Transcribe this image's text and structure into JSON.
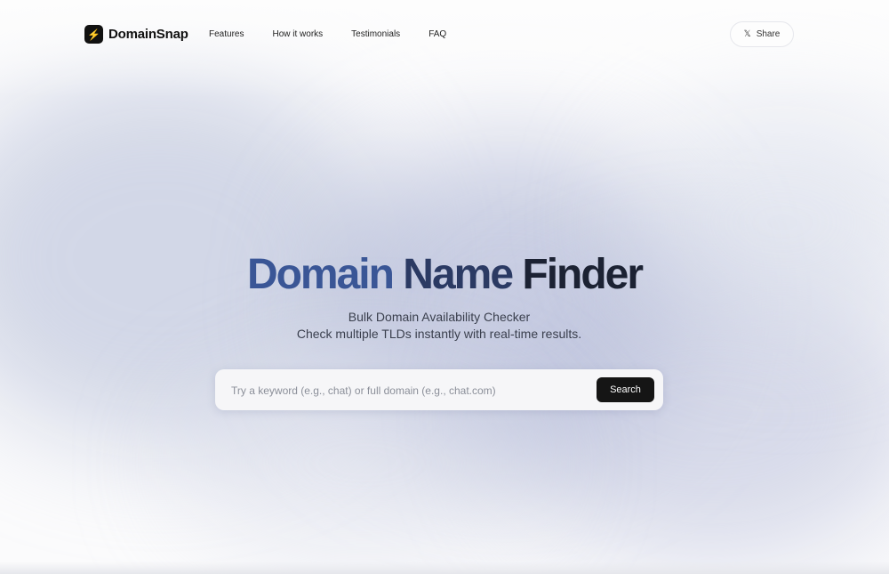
{
  "brand": {
    "name": "DomainSnap",
    "logo_icon": "lightning-icon"
  },
  "nav": {
    "items": [
      {
        "label": "Features"
      },
      {
        "label": "How it works"
      },
      {
        "label": "Testimonials"
      },
      {
        "label": "FAQ"
      }
    ]
  },
  "share": {
    "label": "Share",
    "icon": "x-logo-icon"
  },
  "hero": {
    "title_part1": "Domain",
    "title_part2": "Name",
    "title_part3": "Finder",
    "subtitle_line1": "Bulk Domain Availability Checker",
    "subtitle_line2": "Check multiple TLDs instantly with real-time results."
  },
  "search": {
    "placeholder": "Try a keyword (e.g., chat) or full domain (e.g., chat.com)",
    "value": "",
    "button_label": "Search"
  },
  "colors": {
    "title_blue": "#3a5696",
    "title_navy": "#2b3a63",
    "title_dark": "#1c2233",
    "button_bg": "#151515",
    "logo_bg": "#111111"
  }
}
